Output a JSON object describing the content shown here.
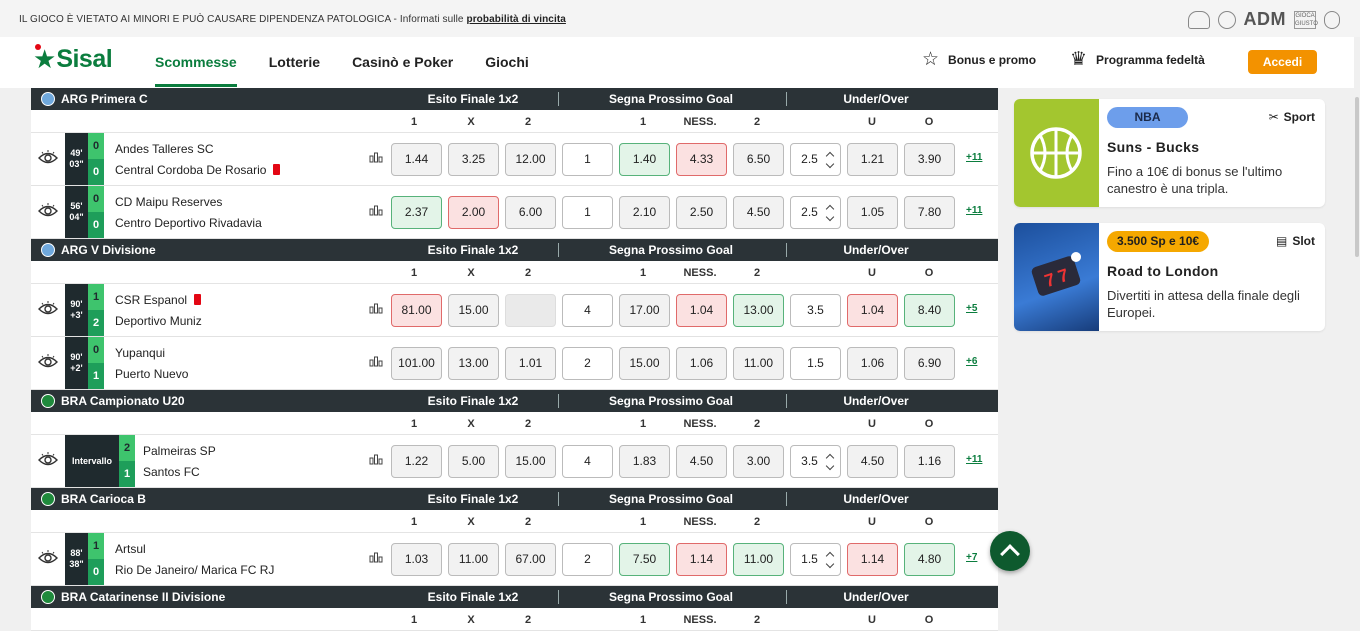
{
  "topbar": {
    "warning": "IL GIOCO È VIETATO AI MINORI E PUÒ CAUSARE DIPENDENZA PATOLOGICA - Informati sulle ",
    "link": "probabilità di vincita",
    "adm": "ADM",
    "gioco_label": "GIOCA GIUSTO"
  },
  "nav": {
    "logo": "Sisal",
    "menu": [
      "Scommesse",
      "Lotterie",
      "Casinò e Poker",
      "Giochi"
    ],
    "bonus": "Bonus e promo",
    "fedelta": "Programma fedeltà",
    "login": "Accedi"
  },
  "headers": {
    "g1": "Esito Finale 1x2",
    "g2": "Segna Prossimo Goal",
    "g3": "Under/Over",
    "sub": [
      "1",
      "X",
      "2",
      "1",
      "NESS.",
      "2",
      "U",
      "O"
    ]
  },
  "leagues": [
    {
      "name": "ARG Primera C",
      "flag": "ar",
      "matches": [
        {
          "time": [
            "49'",
            "03\""
          ],
          "score": [
            "0",
            "0"
          ],
          "home": "Andes Talleres SC",
          "away": "Central Cordoba De Rosario",
          "redcard": "away",
          "odds": [
            "1.44",
            "3.25",
            "12.00",
            "1",
            "1.40",
            "4.33",
            "6.50",
            "2.5",
            "1.21",
            "3.90"
          ],
          "states": [
            "n",
            "n",
            "n",
            "w",
            "up",
            "down",
            "n",
            "sel",
            "n",
            "n"
          ],
          "more": "+11"
        },
        {
          "time": [
            "56'",
            "04\""
          ],
          "score": [
            "0",
            "0"
          ],
          "home": "CD Maipu Reserves",
          "away": "Centro Deportivo Rivadavia",
          "redcard": "",
          "odds": [
            "2.37",
            "2.00",
            "6.00",
            "1",
            "2.10",
            "2.50",
            "4.50",
            "2.5",
            "1.05",
            "7.80"
          ],
          "states": [
            "up",
            "down",
            "n",
            "w",
            "n",
            "n",
            "n",
            "sel",
            "n",
            "n"
          ],
          "more": "+11"
        }
      ]
    },
    {
      "name": "ARG V Divisione",
      "flag": "ar",
      "matches": [
        {
          "time": [
            "90'",
            "+3'"
          ],
          "score": [
            "1",
            "2"
          ],
          "home": "CSR Espanol",
          "away": "Deportivo Muniz",
          "redcard": "home",
          "odds": [
            "81.00",
            "15.00",
            "-",
            "4",
            "17.00",
            "1.04",
            "13.00",
            "3.5",
            "1.04",
            "8.40"
          ],
          "states": [
            "down",
            "n",
            "dis",
            "w",
            "n",
            "down",
            "up",
            "w",
            "down",
            "up"
          ],
          "more": "+5"
        },
        {
          "time": [
            "90'",
            "+2'"
          ],
          "score": [
            "0",
            "1"
          ],
          "home": "Yupanqui",
          "away": "Puerto Nuevo",
          "redcard": "",
          "odds": [
            "101.00",
            "13.00",
            "1.01",
            "2",
            "15.00",
            "1.06",
            "11.00",
            "1.5",
            "1.06",
            "6.90"
          ],
          "states": [
            "n",
            "n",
            "n",
            "w",
            "n",
            "n",
            "n",
            "w",
            "n",
            "n"
          ],
          "more": "+6"
        }
      ]
    },
    {
      "name": "BRA Campionato U20",
      "flag": "br",
      "matches": [
        {
          "time": [
            "Intervallo"
          ],
          "score": [
            "2",
            "1"
          ],
          "home": "Palmeiras SP",
          "away": "Santos FC",
          "redcard": "",
          "odds": [
            "1.22",
            "5.00",
            "15.00",
            "4",
            "1.83",
            "4.50",
            "3.00",
            "3.5",
            "4.50",
            "1.16"
          ],
          "states": [
            "n",
            "n",
            "n",
            "w",
            "n",
            "n",
            "n",
            "sel",
            "n",
            "n"
          ],
          "more": "+11"
        }
      ]
    },
    {
      "name": "BRA Carioca B",
      "flag": "br",
      "matches": [
        {
          "time": [
            "88'",
            "38\""
          ],
          "score": [
            "1",
            "0"
          ],
          "home": "Artsul",
          "away": "Rio De Janeiro/ Marica FC RJ",
          "redcard": "",
          "odds": [
            "1.03",
            "11.00",
            "67.00",
            "2",
            "7.50",
            "1.14",
            "11.00",
            "1.5",
            "1.14",
            "4.80"
          ],
          "states": [
            "n",
            "n",
            "n",
            "w",
            "up",
            "down",
            "up",
            "sel",
            "down",
            "up"
          ],
          "more": "+7"
        }
      ]
    },
    {
      "name": "BRA Catarinense II Divisione",
      "flag": "br",
      "matches": []
    }
  ],
  "promos": [
    {
      "badge": "NBA",
      "badge_color": "#6d9eeb",
      "category": "Sport",
      "title": "Suns - Bucks",
      "desc": "Fino a 10€ di bonus se l'ultimo canestro è una tripla."
    },
    {
      "badge": "3.500 Sp e 10€",
      "badge_color": "#f5a800",
      "category": "Slot",
      "title": "Road to London",
      "desc": "Divertiti in attesa della finale degli Europei."
    }
  ]
}
